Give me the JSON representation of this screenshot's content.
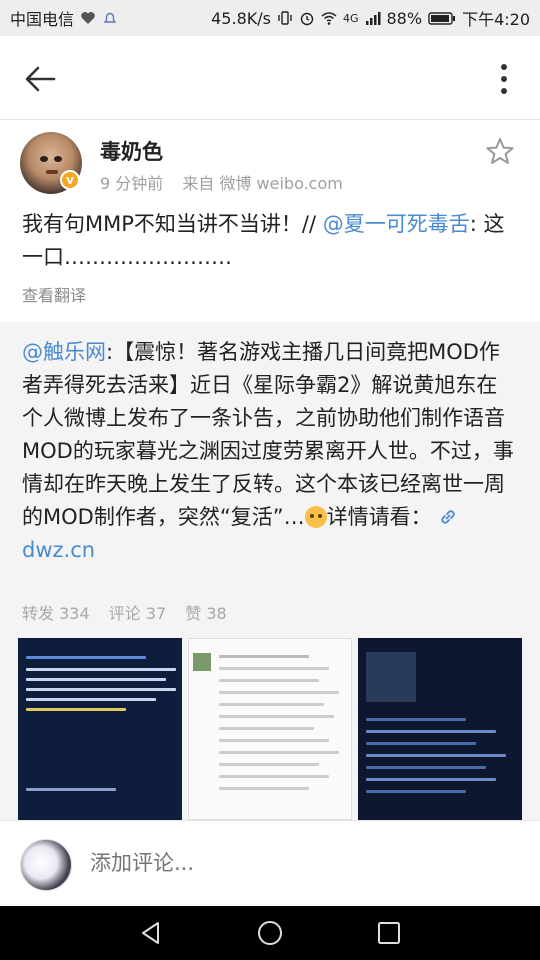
{
  "status_bar": {
    "carrier": "中国电信",
    "speed": "45.8K/s",
    "network": "4G",
    "battery": "88%",
    "time": "下午4:20"
  },
  "post": {
    "username": "毒奶色",
    "time_ago": "9 分钟前",
    "source": "来自 微博 weibo.com",
    "text_prefix": "我有句MMP不知当讲不当讲！// ",
    "mention": "@夏一可死毒舌",
    "text_suffix": ": 这一口……………………",
    "translate_label": "查看翻译"
  },
  "retweet": {
    "mention": "@触乐网",
    "text": ":【震惊！著名游戏主播几日间竟把MOD作者弄得死去活来】近日《星际争霸2》解说黄旭东在个人微博上发布了一条讣告，之前协助他们制作语音MOD的玩家暮光之渊因过度劳累离开人世。不过，事情却在昨天晚上发生了反转。这个本该已经离世一周的MOD制作者，突然“复活”…",
    "text_after_emoji": "详情请看：",
    "link_text": "dwz.cn",
    "reposts": "转发 334",
    "comments": "评论 37",
    "likes": "赞 38"
  },
  "comment_bar": {
    "placeholder": "添加评论..."
  },
  "colors": {
    "link": "#4a8ad1",
    "badge": "#f5a623",
    "muted": "#a0a0a0"
  }
}
